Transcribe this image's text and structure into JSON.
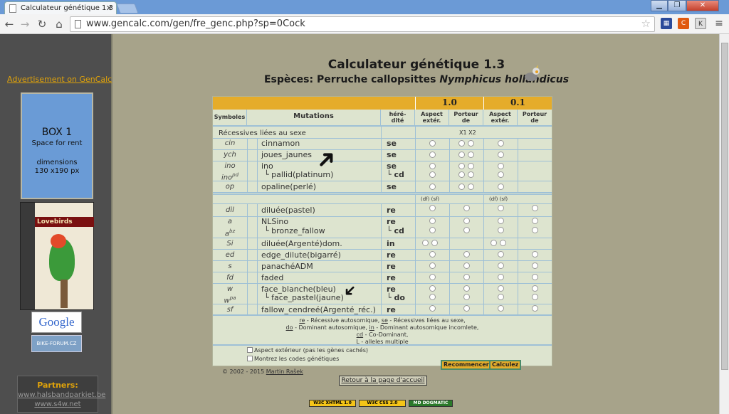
{
  "browser": {
    "tab_title": "Calculateur génétique 1.3",
    "url": "www.gencalc.com/gen/fre_genc.php?sp=0Cock"
  },
  "sidebar": {
    "ad_link": "Advertisement on GenCalc",
    "box_title": "BOX 1",
    "box_sub": "Space for rent",
    "box_dim1": "dimensions",
    "box_dim2": "130 x190 px",
    "book_title": "Lovebirds",
    "google": "Google",
    "bikeforum": "BIKE-FORUM.CZ",
    "partners_title": "Partners:",
    "partner1": "www.halsbandparkiet.be",
    "partner2": "www.s4w.net"
  },
  "header": {
    "title": "Calculateur génétique 1.3",
    "species_prefix": "Espèces: Perruche callopsittes",
    "species_latin": "Nymphicus hollandicus"
  },
  "table": {
    "h_male": "1.0",
    "h_female": "0.1",
    "col_sym": "Symboles",
    "col_mut": "Mutations",
    "col_her1": "héré-",
    "col_her2": "dité",
    "col_asp1": "Aspect",
    "col_asp2": "extér.",
    "col_port1": "Porteur",
    "col_port2": "de",
    "col_asp1b": "Aspect",
    "col_asp2b": "extér.",
    "col_port1b": "Porteur",
    "col_port2b": "de",
    "sect1": "Récessives liées au sexe",
    "x1x2": "X1 X2",
    "df_sf_1": "(df)  (sf)",
    "df_sf_2": "(df)  (sf)",
    "r_cin_s": "cin",
    "r_cin_m": "cinnamon",
    "r_cin_h": "se",
    "r_ych_s": "ych",
    "r_ych_m": "joues_jaunes",
    "r_ych_h": "se",
    "r_ino_s": "ino",
    "r_ino_m": "ino",
    "r_ino_h": "se",
    "r_inopd_s": "ino",
    "r_inopd_sup": "pd",
    "r_inopd_m": "pallid(platinum)",
    "r_inopd_h": "cd",
    "r_op_s": "op",
    "r_op_m": "opaline(perlé)",
    "r_op_h": "se",
    "r_dil_s": "dil",
    "r_dil_m": "diluée(pastel)",
    "r_dil_h": "re",
    "r_a_s": "a",
    "r_a_m": "NLSino",
    "r_a_h": "re",
    "r_abz_s": "a",
    "r_abz_sup": "bz",
    "r_abz_m": "bronze_fallow",
    "r_abz_h": "cd",
    "r_si_s": "Si",
    "r_si_m": "diluée(Argenté)dom.",
    "r_si_h": "in",
    "r_ed_s": "ed",
    "r_ed_m": "edge_dilute(bigarré)",
    "r_ed_h": "re",
    "r_s_s": "s",
    "r_s_m": "panachéADM",
    "r_s_h": "re",
    "r_fd_s": "fd",
    "r_fd_m": "faded",
    "r_fd_h": "re",
    "r_w_s": "w",
    "r_w_m": "face_blanche(bleu)",
    "r_w_h": "re",
    "r_wpa_s": "w",
    "r_wpa_sup": "pa",
    "r_wpa_m": "face_pastel(jaune)",
    "r_wpa_h": "do",
    "r_sf_s": "sf",
    "r_sf_m": "fallow_cendreé(Argenté_réc.)",
    "r_sf_h": "re",
    "lg1a": "re",
    "lg1b": " - Récessive autosomique, ",
    "lg1c": "se",
    "lg1d": " - Récessives liées au sexe,",
    "lg2a": "do",
    "lg2b": " - Dominant autosomique, ",
    "lg2c": "in",
    "lg2d": " - Dominant autosomique incomlete,",
    "lg3a": "cd",
    "lg3b": " - Co-Dominant,",
    "lg4a": "L",
    "lg4b": " - alleles multiple",
    "opt1": "Aspect extérieur (pas les gènes cachés)",
    "opt2": "Montrez les codes génétiques",
    "btn_reset": "Recommencer",
    "btn_calc": "Calculez"
  },
  "footer": {
    "copy": "© 2002 - 2015 ",
    "author": "Martin Rašek",
    "retour": "Retour à la page d'accueil",
    "b1": "W3C XHTML 1.0",
    "b2": "W3C CSS 2.0",
    "b3": "MD DOGMATIC"
  }
}
